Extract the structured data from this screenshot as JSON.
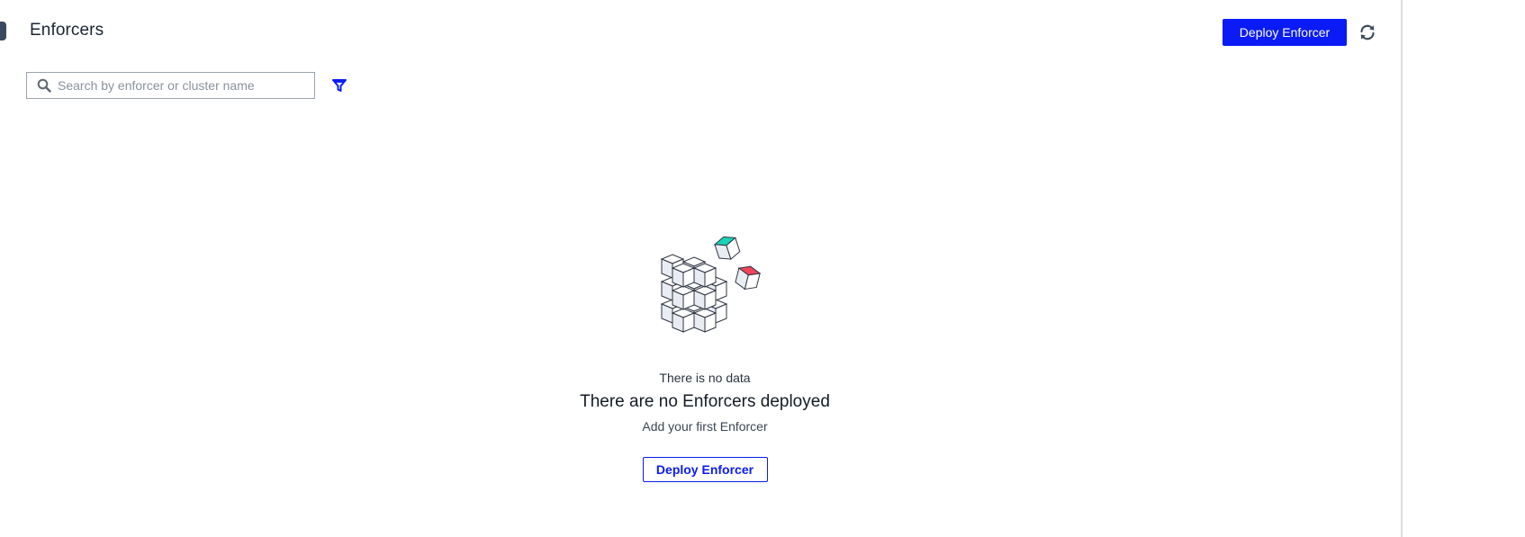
{
  "header": {
    "title": "Enforcers",
    "deploy_label": "Deploy Enforcer",
    "refresh_icon": "refresh-icon"
  },
  "toolbar": {
    "search_placeholder": "Search by enforcer or cluster name",
    "search_value": "",
    "search_icon": "search-icon",
    "filter_icon": "filter-icon"
  },
  "empty_state": {
    "illustration": "cubes-illustration",
    "no_data_text": "There is no data",
    "title": "There are no Enforcers deployed",
    "subtitle": "Add your first Enforcer",
    "deploy_label": "Deploy Enforcer"
  },
  "colors": {
    "accent": "#0a1bf5",
    "cube_teal": "#19d3b8",
    "cube_red": "#f0455a"
  }
}
